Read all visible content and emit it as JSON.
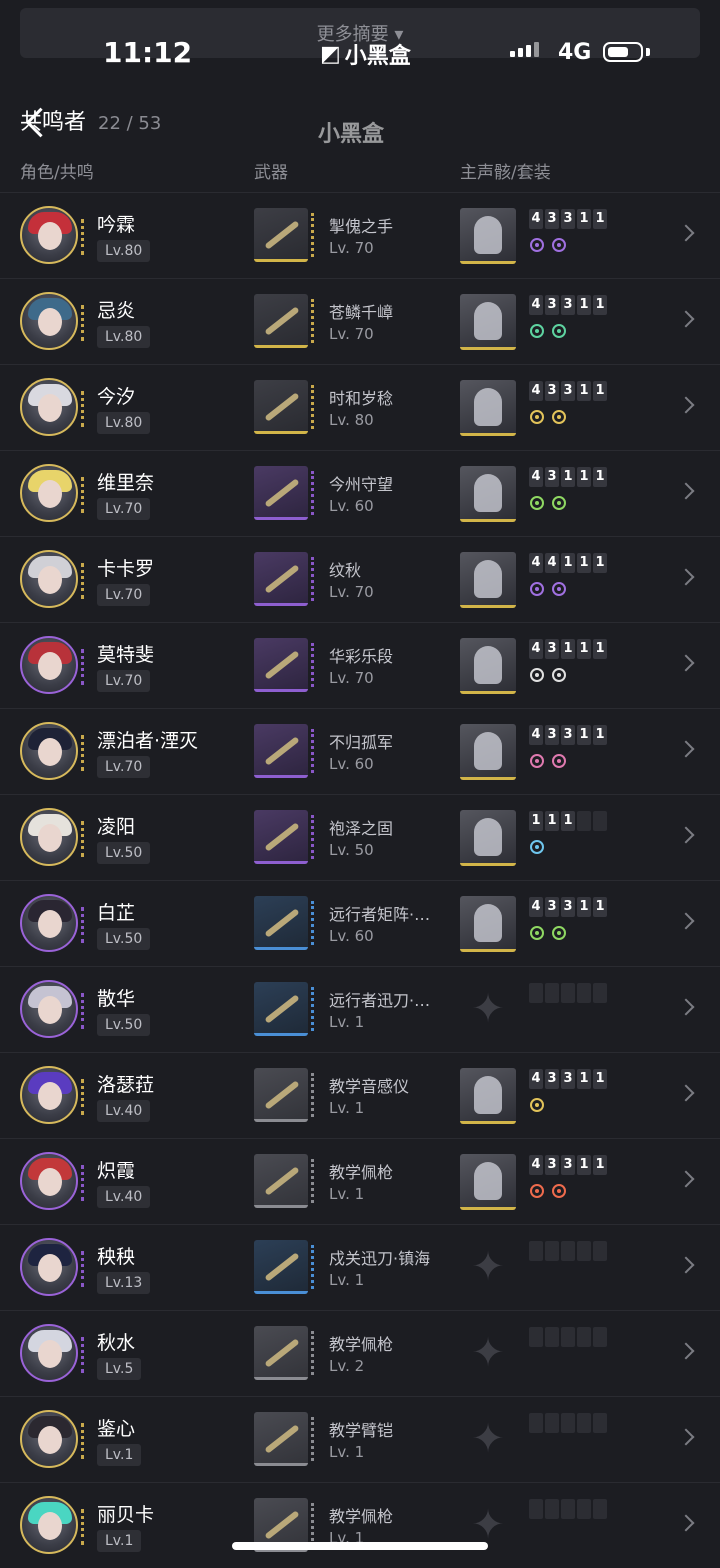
{
  "status_bar": {
    "time": "11:12",
    "app_logo": "小黑盒",
    "network": "4G"
  },
  "top": {
    "summary_label": "更多摘要",
    "summary_icon": "caret-down-icon"
  },
  "header": {
    "title": "共鸣者",
    "count": "22 / 53",
    "watermark": "小黑盒"
  },
  "columns": {
    "character": "角色/共鸣",
    "weapon": "武器",
    "echo": "主声骸/套装"
  },
  "colors": {
    "gold": "#d2b549",
    "purple": "#8e5fd0",
    "blue": "#4a8fd6",
    "grey": "#8b8c92",
    "background": "#1c1d22"
  },
  "rows": [
    {
      "name": "吟霖",
      "level": "Lv.80",
      "frame": "gold",
      "weapon": "掣傀之手",
      "weapon_level": "Lv. 70",
      "weapon_rarity": "rare5",
      "costs": [
        "4",
        "3",
        "3",
        "1",
        "1"
      ],
      "set_color": "#a070e0",
      "set_count": 2,
      "echo": true
    },
    {
      "name": "忌炎",
      "level": "Lv.80",
      "frame": "gold",
      "weapon": "苍鳞千嶂",
      "weapon_level": "Lv. 70",
      "weapon_rarity": "rare5",
      "costs": [
        "4",
        "3",
        "3",
        "1",
        "1"
      ],
      "set_color": "#5ed3a0",
      "set_count": 2,
      "echo": true
    },
    {
      "name": "今汐",
      "level": "Lv.80",
      "frame": "gold",
      "weapon": "时和岁稔",
      "weapon_level": "Lv. 80",
      "weapon_rarity": "rare5",
      "costs": [
        "4",
        "3",
        "3",
        "1",
        "1"
      ],
      "set_color": "#e2c35a",
      "set_count": 2,
      "echo": true
    },
    {
      "name": "维里奈",
      "level": "Lv.70",
      "frame": "gold",
      "weapon": "今州守望",
      "weapon_level": "Lv. 60",
      "weapon_rarity": "rare4",
      "costs": [
        "4",
        "3",
        "1",
        "1",
        "1"
      ],
      "set_color": "#8fd862",
      "set_count": 2,
      "echo": true
    },
    {
      "name": "卡卡罗",
      "level": "Lv.70",
      "frame": "gold",
      "weapon": "纹秋",
      "weapon_level": "Lv. 70",
      "weapon_rarity": "rare4",
      "costs": [
        "4",
        "4",
        "1",
        "1",
        "1"
      ],
      "set_color": "#a070e0",
      "set_count": 2,
      "echo": true
    },
    {
      "name": "莫特斐",
      "level": "Lv.70",
      "frame": "purple",
      "weapon": "华彩乐段",
      "weapon_level": "Lv. 70",
      "weapon_rarity": "rare4",
      "costs": [
        "4",
        "3",
        "1",
        "1",
        "1"
      ],
      "set_color": "#e0e0e0",
      "set_count": 2,
      "echo": true
    },
    {
      "name": "漂泊者·湮灭",
      "level": "Lv.70",
      "frame": "gold",
      "weapon": "不归孤军",
      "weapon_level": "Lv. 60",
      "weapon_rarity": "rare4",
      "costs": [
        "4",
        "3",
        "3",
        "1",
        "1"
      ],
      "set_color": "#e07ab0",
      "set_count": 2,
      "echo": true
    },
    {
      "name": "凌阳",
      "level": "Lv.50",
      "frame": "gold",
      "weapon": "袍泽之固",
      "weapon_level": "Lv. 50",
      "weapon_rarity": "rare4",
      "costs": [
        "1",
        "1",
        "1",
        "",
        ""
      ],
      "set_color": "#6fc6ee",
      "set_count": 1,
      "echo": true
    },
    {
      "name": "白芷",
      "level": "Lv.50",
      "frame": "purple",
      "weapon": "远行者矩阵·探幽",
      "weapon_level": "Lv. 60",
      "weapon_rarity": "rare3",
      "costs": [
        "4",
        "3",
        "3",
        "1",
        "1"
      ],
      "set_color": "#8fd862",
      "set_count": 2,
      "echo": true
    },
    {
      "name": "散华",
      "level": "Lv.50",
      "frame": "purple",
      "weapon": "远行者迅刀·旅迹",
      "weapon_level": "Lv. 1",
      "weapon_rarity": "rare3",
      "costs": [
        "",
        "",
        "",
        "",
        ""
      ],
      "set_color": "#444",
      "set_count": 0,
      "echo": false
    },
    {
      "name": "洛瑟菈",
      "level": "Lv.40",
      "frame": "gold",
      "weapon": "教学音感仪",
      "weapon_level": "Lv. 1",
      "weapon_rarity": "rare1",
      "costs": [
        "4",
        "3",
        "3",
        "1",
        "1"
      ],
      "set_color": "#e2c35a",
      "set_count": 1,
      "echo": true
    },
    {
      "name": "炽霞",
      "level": "Lv.40",
      "frame": "purple",
      "weapon": "教学佩枪",
      "weapon_level": "Lv. 1",
      "weapon_rarity": "rare1",
      "costs": [
        "4",
        "3",
        "3",
        "1",
        "1"
      ],
      "set_color": "#ef6b4d",
      "set_count": 2,
      "echo": true
    },
    {
      "name": "秧秧",
      "level": "Lv.13",
      "frame": "purple",
      "weapon": "戍关迅刀·镇海",
      "weapon_level": "Lv. 1",
      "weapon_rarity": "rare3",
      "costs": [
        "",
        "",
        "",
        "",
        ""
      ],
      "set_color": "#444",
      "set_count": 0,
      "echo": false
    },
    {
      "name": "秋水",
      "level": "Lv.5",
      "frame": "purple",
      "weapon": "教学佩枪",
      "weapon_level": "Lv. 2",
      "weapon_rarity": "rare1",
      "costs": [
        "",
        "",
        "",
        "",
        ""
      ],
      "set_color": "#444",
      "set_count": 0,
      "echo": false
    },
    {
      "name": "鉴心",
      "level": "Lv.1",
      "frame": "gold",
      "weapon": "教学臂铠",
      "weapon_level": "Lv. 1",
      "weapon_rarity": "rare1",
      "costs": [
        "",
        "",
        "",
        "",
        ""
      ],
      "set_color": "#444",
      "set_count": 0,
      "echo": false
    },
    {
      "name": "丽贝卡",
      "level": "Lv.1",
      "frame": "gold",
      "weapon": "教学佩枪",
      "weapon_level": "Lv. 1",
      "weapon_rarity": "rare1",
      "costs": [
        "",
        "",
        "",
        "",
        ""
      ],
      "set_color": "#444",
      "set_count": 0,
      "echo": false
    }
  ]
}
